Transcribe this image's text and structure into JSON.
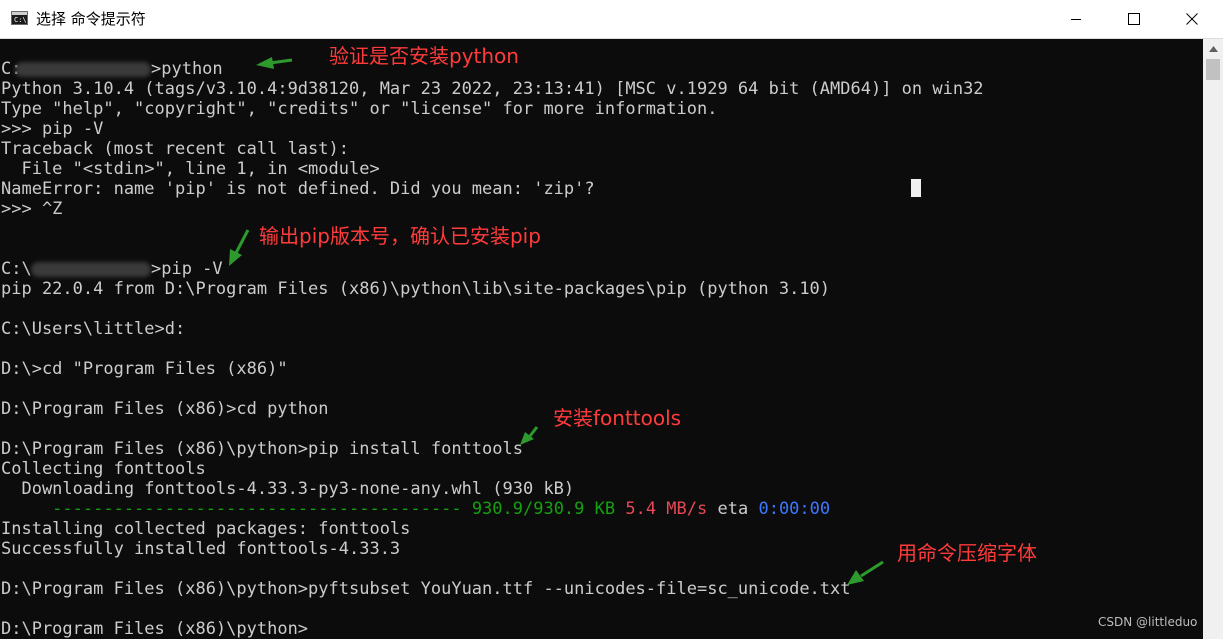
{
  "window": {
    "title": "选择 命令提示符",
    "icon": "cmd-console-icon",
    "icon_glyph": "C:\\",
    "controls": [
      "minimize-icon",
      "maximize-icon",
      "close-icon"
    ]
  },
  "console": {
    "lines": [
      {
        "pre": "C:",
        "post": ">python"
      },
      "Python 3.10.4 (tags/v3.10.4:9d38120, Mar 23 2022, 23:13:41) [MSC v.1929 64 bit (AMD64)] on win32",
      "Type \"help\", \"copyright\", \"credits\" or \"license\" for more information.",
      ">>> pip -V",
      "Traceback (most recent call last):",
      "  File \"<stdin>\", line 1, in <module>",
      "NameError: name 'pip' is not defined. Did you mean: 'zip'?",
      ">>> ^Z",
      "",
      "",
      {
        "pre": "C:\\",
        "post": ">pip -V"
      },
      "pip 22.0.4 from D:\\Program Files (x86)\\python\\lib\\site-packages\\pip (python 3.10)",
      "",
      "C:\\Users\\little>d:",
      "",
      "D:\\>cd \"Program Files (x86)\"",
      "",
      "D:\\Program Files (x86)>cd python",
      "",
      "D:\\Program Files (x86)\\python>pip install fonttools",
      "Collecting fonttools",
      "  Downloading fonttools-4.33.3-py3-none-any.whl (930 kB)",
      {
        "bar": "     ---------------------------------------- ",
        "size": "930.9/930.9 KB",
        "speed": "5.4 MB/s",
        "eta_label": "eta",
        "eta": "0:00:00"
      },
      "Installing collected packages: fonttools",
      "Successfully installed fonttools-4.33.3",
      "",
      "D:\\Program Files (x86)\\python>pyftsubset YouYuan.ttf --unicodes-file=sc_unicode.txt",
      "",
      "D:\\Program Files (x86)\\python>"
    ]
  },
  "annotations": [
    {
      "text": "验证是否安装python"
    },
    {
      "text": "输出pip版本号，确认已安装pip"
    },
    {
      "text": "安装fonttools"
    },
    {
      "text": "用命令压缩字体"
    }
  ],
  "colors": {
    "background": "#0c0c0c",
    "text": "#cccccc",
    "annotation": "#ff3b3b",
    "arrow": "#2e9a2e",
    "progress": "#13a10e",
    "speed": "#e74856",
    "eta": "#3b78ff"
  },
  "watermark": "CSDN @littleduo"
}
